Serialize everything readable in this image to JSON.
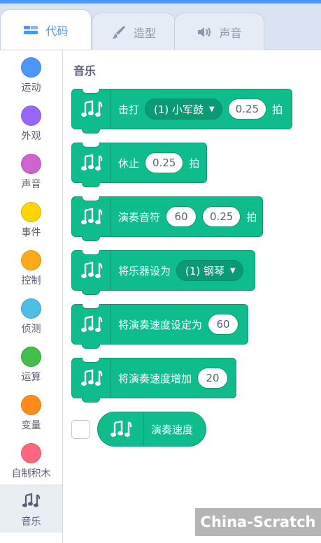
{
  "tabs": [
    {
      "label": "代码",
      "icon": "code-icon",
      "active": true
    },
    {
      "label": "造型",
      "icon": "brush-icon",
      "active": false
    },
    {
      "label": "声音",
      "icon": "speaker-icon",
      "active": false
    }
  ],
  "categories": [
    {
      "label": "运动",
      "color": "#4c97ff"
    },
    {
      "label": "外观",
      "color": "#9966ff"
    },
    {
      "label": "声音",
      "color": "#cf63cf"
    },
    {
      "label": "事件",
      "color": "#ffd500"
    },
    {
      "label": "控制",
      "color": "#ffab19"
    },
    {
      "label": "侦测",
      "color": "#4cbfe6"
    },
    {
      "label": "运算",
      "color": "#40bf4a"
    },
    {
      "label": "变量",
      "color": "#ff8c1a"
    },
    {
      "label": "自制积木",
      "color": "#ff6680"
    },
    {
      "label": "音乐",
      "icon": "music-notes-icon",
      "selected": true
    }
  ],
  "palette": {
    "section_title": "音乐",
    "blocks": {
      "play_drum": {
        "label": "击打",
        "drum": "(1) 小军鼓",
        "beats": "0.25",
        "suffix": "拍"
      },
      "rest": {
        "label": "休止",
        "beats": "0.25",
        "suffix": "拍"
      },
      "play_note": {
        "label": "演奏音符",
        "note": "60",
        "beats": "0.25",
        "suffix": "拍"
      },
      "set_instrument": {
        "label": "将乐器设为",
        "instrument": "(1) 钢琴"
      },
      "set_tempo": {
        "label": "将演奏速度设定为",
        "value": "60"
      },
      "change_tempo": {
        "label": "将演奏速度增加",
        "value": "20"
      },
      "tempo_reporter": {
        "label": "演奏速度"
      }
    }
  },
  "colors": {
    "accent": "#4c97ff",
    "music_block": "#0fbd8c"
  },
  "watermark": "China-Scratch"
}
